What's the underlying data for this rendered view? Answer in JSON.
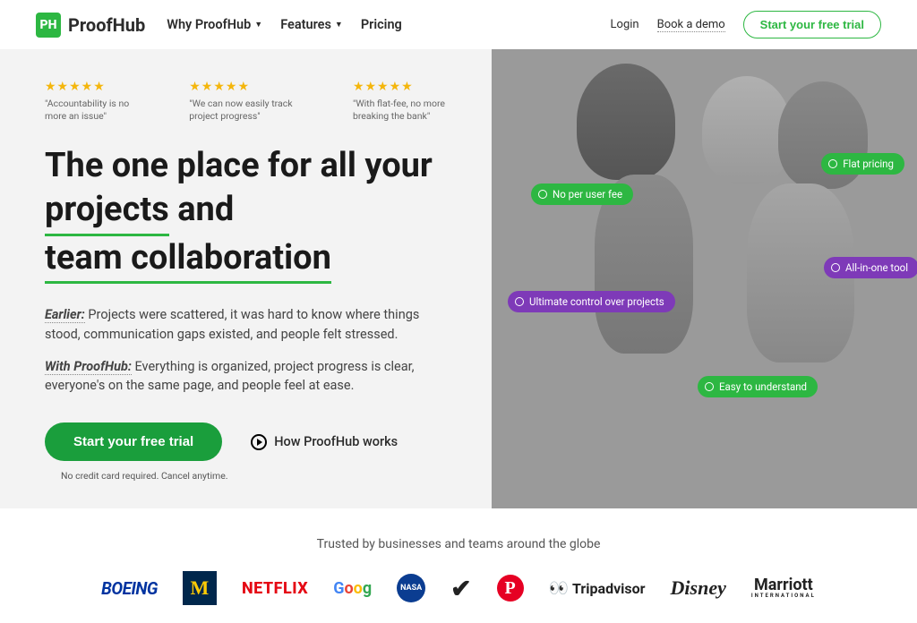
{
  "header": {
    "logo_text": "ProofHub",
    "logo_abbr": "PH",
    "nav_items": [
      {
        "label": "Why ProofHub",
        "dropdown": true
      },
      {
        "label": "Features",
        "dropdown": true
      },
      {
        "label": "Pricing",
        "dropdown": false
      }
    ],
    "login": "Login",
    "demo": "Book a demo",
    "trial": "Start your free trial"
  },
  "hero": {
    "reviews": [
      {
        "text": "\"Accountability is no more an issue\""
      },
      {
        "text": "\"We can now easily track project progress\""
      },
      {
        "text": "\"With flat-fee, no more breaking the bank\""
      }
    ],
    "headline_parts": {
      "p1": "The one place for all your ",
      "u1": "projects",
      "p2": " and ",
      "u2": "team collaboration"
    },
    "para1_label": "Earlier:",
    "para1_body": " Projects were scattered, it was hard to know where things stood, communication gaps existed, and people felt stressed.",
    "para2_label": "With ProofHub:",
    "para2_body": " Everything is organized, project progress is clear, everyone's on the same page, and people feel at ease.",
    "cta_trial": "Start your free trial",
    "cta_how": "How ProofHub works",
    "sub_text": "No credit card required. Cancel anytime.",
    "pills": {
      "flat_pricing": "Flat pricing",
      "no_per_user": "No per user fee",
      "all_in_one": "All-in-one tool",
      "ultimate_control": "Ultimate control over projects",
      "easy": "Easy to understand"
    }
  },
  "trusted": {
    "heading": "Trusted by businesses and teams around the globe",
    "brands": {
      "boeing": "BOEING",
      "michigan": "M",
      "netflix": "NETFLIX",
      "nasa": "NASA",
      "tripadvisor": "Tripadvisor",
      "disney": "Disney",
      "marriott": "Marriott",
      "marriott_sub": "INTERNATIONAL"
    }
  }
}
